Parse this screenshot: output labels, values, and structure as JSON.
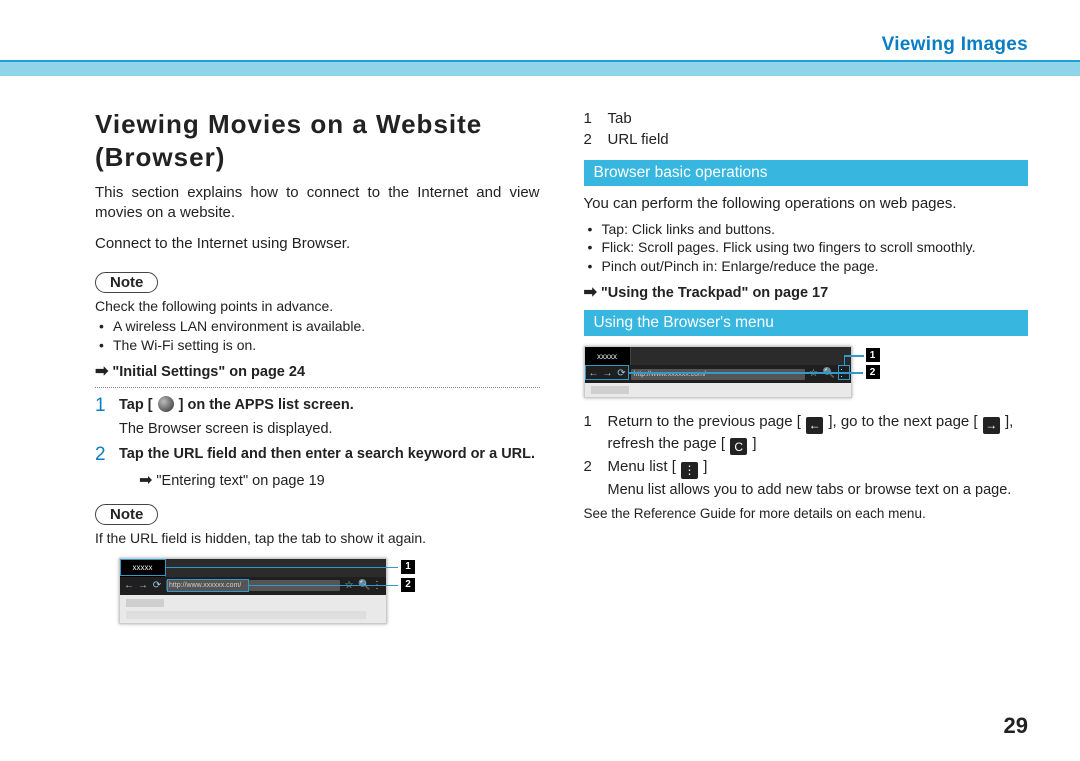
{
  "header": {
    "section_title": "Viewing Images"
  },
  "page_number": "29",
  "left": {
    "heading": "Viewing Movies on a Website (Browser)",
    "intro": "This section explains how to connect to the Internet and view movies on a website.",
    "connect": "Connect to the Internet using Browser.",
    "note_label": "Note",
    "check_intro": "Check the following points in advance.",
    "check_bullets": [
      "A wireless LAN environment is available.",
      "The Wi-Fi setting is on."
    ],
    "ref1_arrow": "➡",
    "ref1": "\"Initial Settings\" on page 24",
    "step1_num": "1",
    "step1_pre": "Tap [",
    "step1_post": "] on the APPS list screen.",
    "step1_sub": "The Browser screen is displayed.",
    "step2_num": "2",
    "step2": "Tap the URL field and then enter a search keyword or a URL.",
    "step2_ref_arrow": "➡",
    "step2_ref": "\"Entering text\" on page 19",
    "note2_label": "Note",
    "note2_body": "If the URL field is hidden, tap the tab to show it again.",
    "fig1_tab_text": "xxxxx",
    "fig1_url_text": "http://www.xxxxxx.com/",
    "fig1_callout1": "1",
    "fig1_callout2": "2"
  },
  "right": {
    "tab_label": "Tab",
    "url_label": "URL field",
    "n1": "1",
    "n2": "2",
    "bar1": "Browser basic operations",
    "ops_intro": "You can perform the following operations on web pages.",
    "ops_bullets": [
      "Tap: Click links and buttons.",
      "Flick: Scroll pages. Flick using two fingers to scroll smoothly.",
      "Pinch out/Pinch in: Enlarge/reduce the page."
    ],
    "ref_arrow": "➡",
    "ref": "\"Using the Trackpad\" on page 17",
    "bar2": "Using the Browser's menu",
    "fig2_tab_text": "xxxxx",
    "fig2_url_text": "http://www.xxxxxx.com/",
    "fig2_callout1": "1",
    "fig2_callout2": "2",
    "desc1_pre": "Return to the previous page [",
    "desc1_mid1": "], go to the next page [",
    "desc1_mid2": "], refresh the page [",
    "desc1_post": "]",
    "desc2_pre": "Menu list [",
    "desc2_post": "]",
    "desc2_sub": "Menu list allows you to add new tabs or browse text on a page.",
    "footnote": "See the Reference Guide for more details on each menu.",
    "icons": {
      "back": "←",
      "forward": "→",
      "refresh": "C",
      "menu": "⋮"
    }
  }
}
